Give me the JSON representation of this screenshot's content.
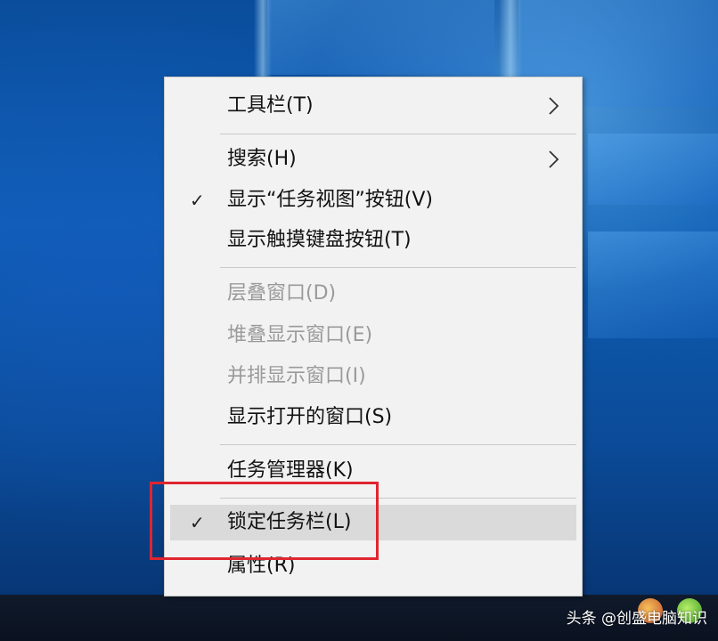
{
  "context_menu": {
    "items": [
      {
        "label": "工具栏(T)",
        "checked": false,
        "disabled": false,
        "submenu": true
      },
      {
        "label": "搜索(H)",
        "checked": false,
        "disabled": false,
        "submenu": true
      },
      {
        "label": "显示“任务视图”按钮(V)",
        "checked": true,
        "disabled": false,
        "submenu": false
      },
      {
        "label": "显示触摸键盘按钮(T)",
        "checked": false,
        "disabled": false,
        "submenu": false
      },
      {
        "label": "层叠窗口(D)",
        "checked": false,
        "disabled": true,
        "submenu": false
      },
      {
        "label": "堆叠显示窗口(E)",
        "checked": false,
        "disabled": true,
        "submenu": false
      },
      {
        "label": "并排显示窗口(I)",
        "checked": false,
        "disabled": true,
        "submenu": false
      },
      {
        "label": "显示打开的窗口(S)",
        "checked": false,
        "disabled": false,
        "submenu": false
      },
      {
        "label": "任务管理器(K)",
        "checked": false,
        "disabled": false,
        "submenu": false
      },
      {
        "label": "锁定任务栏(L)",
        "checked": true,
        "disabled": false,
        "submenu": false,
        "highlighted": true
      },
      {
        "label": "属性(R)",
        "checked": false,
        "disabled": false,
        "submenu": false
      }
    ],
    "check_glyph": "✓"
  },
  "watermark": {
    "text": "头条 @创盛电脑知识"
  },
  "colors": {
    "highlight_box": "#e0252f",
    "menu_bg": "#f2f2f2",
    "disabled_text": "#9a9a9a"
  }
}
